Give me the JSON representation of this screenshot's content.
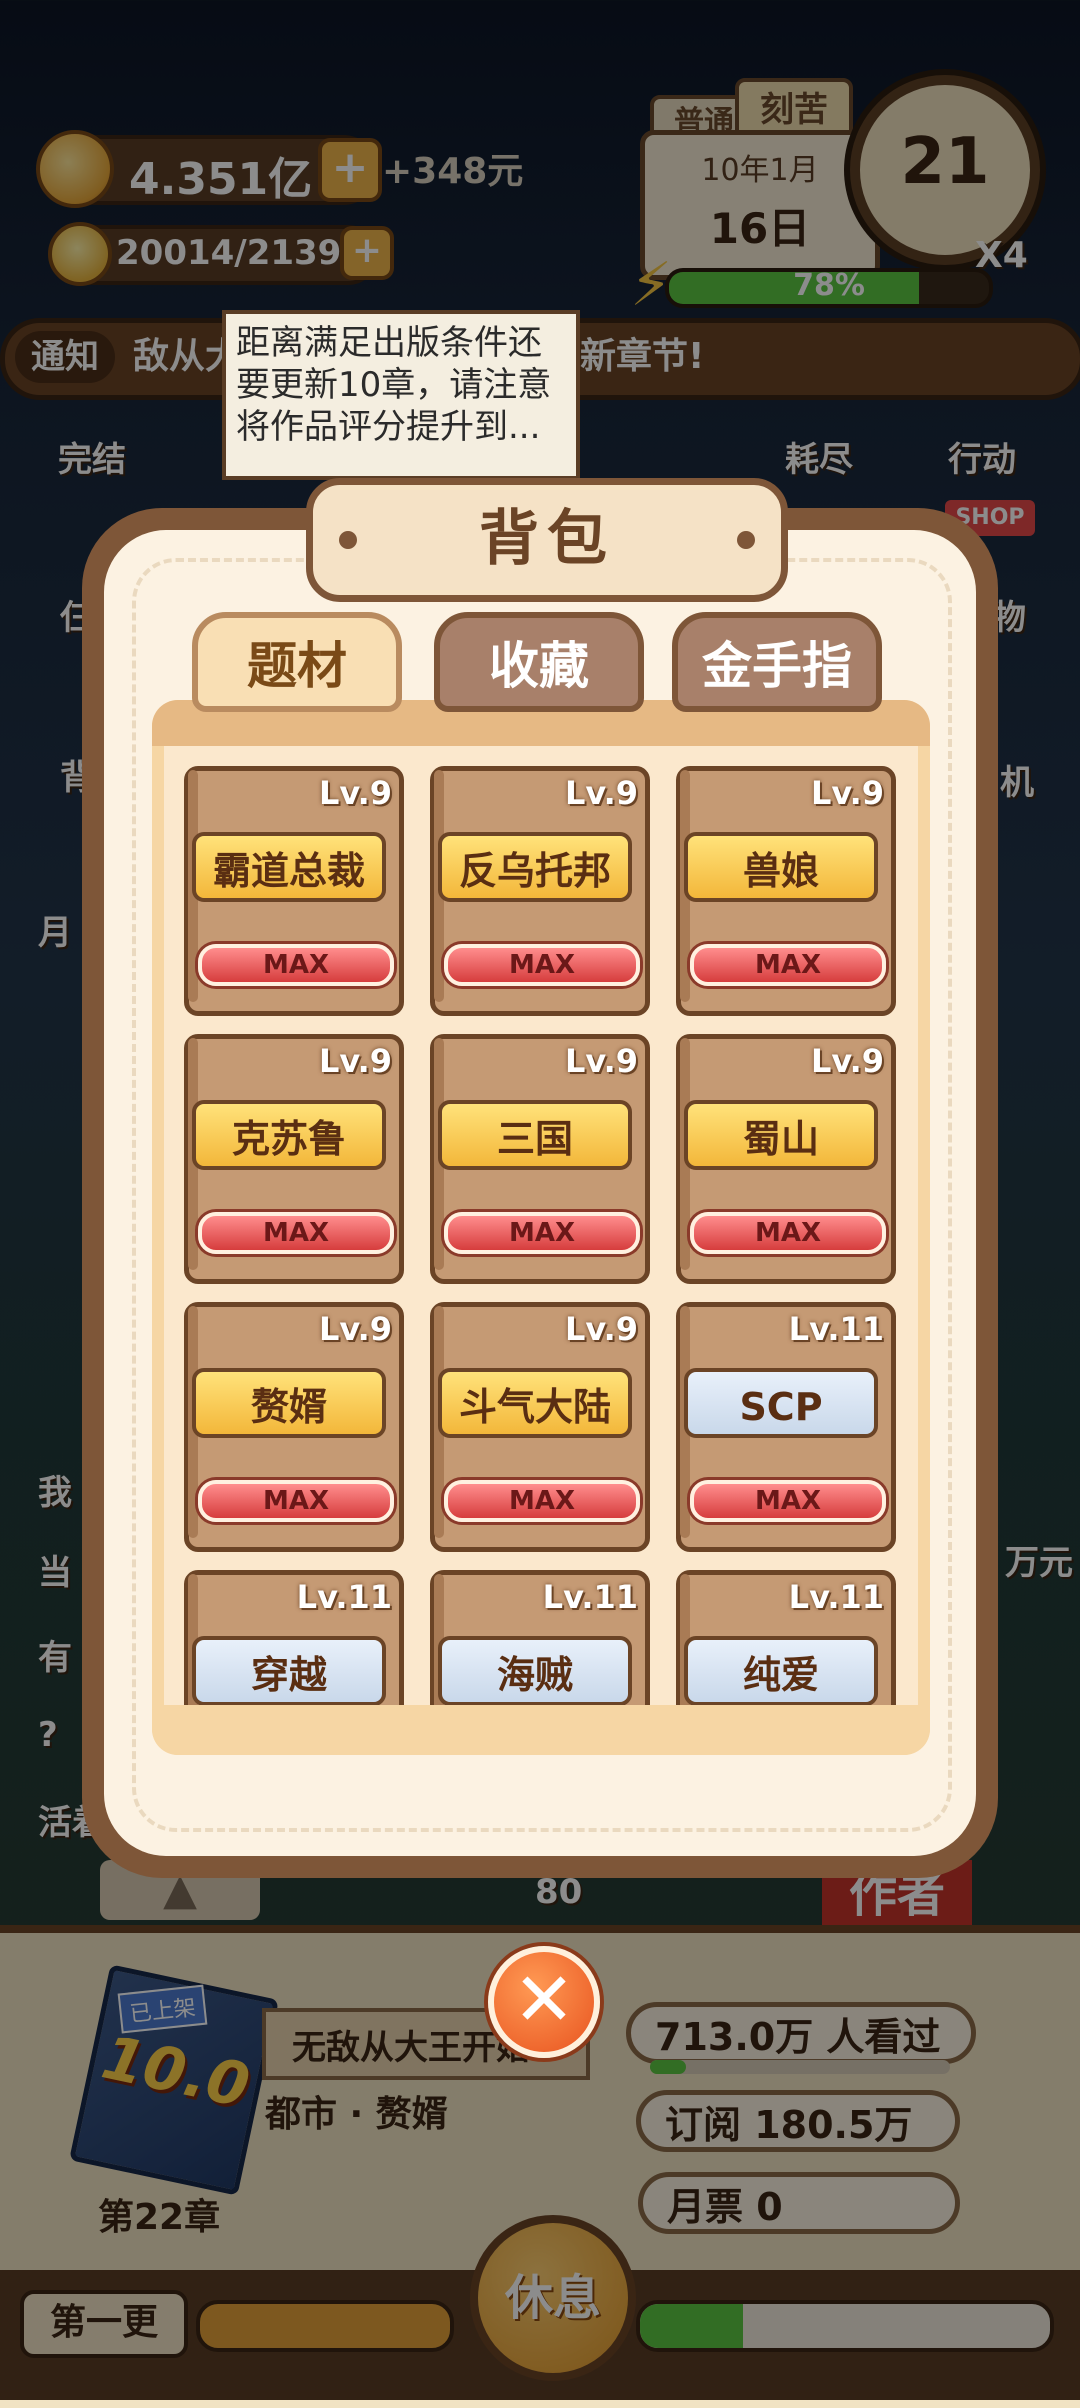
{
  "hud": {
    "coins": "4.351亿",
    "income": "+348元",
    "inspiration": "20014/21399",
    "mode_tag_1": "普通",
    "mode_tag_2": "刻苦",
    "date_ym": "10年1月",
    "date_d": "16日",
    "clock_value": "21",
    "speed": "X4",
    "energy_percent": "78%",
    "energy_fraction": 0.78
  },
  "notice": {
    "tag": "通知",
    "text_left": "敌从大",
    "text_right": "新章节!"
  },
  "side_buttons": {
    "finish": "完结",
    "exhausted": "耗尽",
    "action": "行动",
    "shop": "SHOP",
    "peek_1": "仨",
    "peek_2": "物",
    "peek_3": "背",
    "peek_4": "月",
    "peek_5": "机",
    "peek_6": "我",
    "peek_7": "当",
    "peek_8": "有",
    "peek_9": "?",
    "peek_10": "活着",
    "peek_right": "万元",
    "peek_num": "80",
    "author_tag": "作者"
  },
  "tooltip": {
    "text": "距离满足出版条件还要更新10章，请注意将作品评分提升到..."
  },
  "backpack": {
    "title": "背包",
    "tabs": [
      {
        "label": "题材"
      },
      {
        "label": "收藏"
      },
      {
        "label": "金手指"
      }
    ],
    "items": [
      {
        "lv": "Lv.9",
        "name": "霸道总裁",
        "max": "MAX"
      },
      {
        "lv": "Lv.9",
        "name": "反乌托邦",
        "max": "MAX"
      },
      {
        "lv": "Lv.9",
        "name": "兽娘",
        "max": "MAX"
      },
      {
        "lv": "Lv.9",
        "name": "克苏鲁",
        "max": "MAX"
      },
      {
        "lv": "Lv.9",
        "name": "三国",
        "max": "MAX"
      },
      {
        "lv": "Lv.9",
        "name": "蜀山",
        "max": "MAX"
      },
      {
        "lv": "Lv.9",
        "name": "赘婿",
        "max": "MAX"
      },
      {
        "lv": "Lv.9",
        "name": "斗气大陆",
        "max": "MAX"
      },
      {
        "lv": "Lv.11",
        "name": "SCP",
        "max": "MAX"
      },
      {
        "lv": "Lv.11",
        "name": "穿越",
        "max": ""
      },
      {
        "lv": "Lv.11",
        "name": "海贼",
        "max": ""
      },
      {
        "lv": "Lv.11",
        "name": "纯爱",
        "max": ""
      }
    ]
  },
  "book": {
    "shelved_tag": "已上架",
    "score": "10.0",
    "title": "无敌从大王开始",
    "genre": "都市 · 赘婿",
    "chapter": "第22章",
    "views": "713.0万 人看过",
    "subscriptions": "订阅 180.5万",
    "monthly_tickets": "月票 0",
    "update_label": "第一更",
    "rest_label": "休息"
  }
}
